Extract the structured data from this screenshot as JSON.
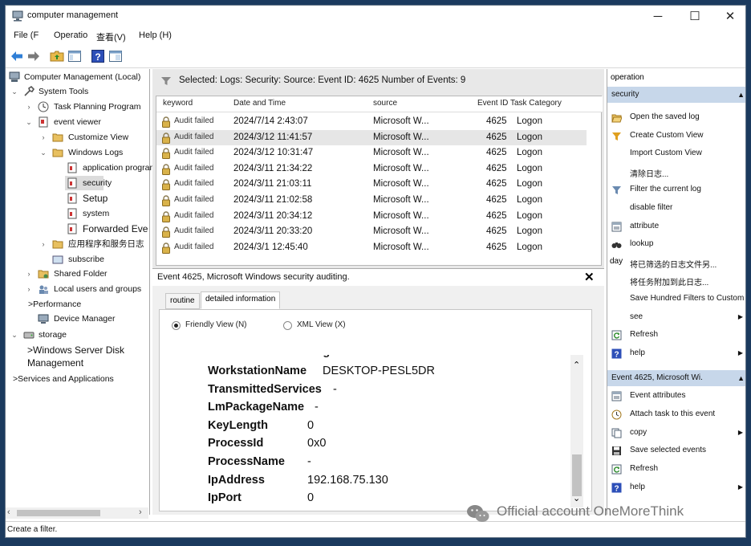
{
  "window": {
    "title": "computer management",
    "app_icon": "computer-management-icon",
    "controls": [
      "─",
      "☐",
      "✕"
    ]
  },
  "menu": [
    "File (F",
    "Operatio",
    "查看(V)",
    "Help (H)"
  ],
  "toolbar": {
    "buttons": [
      "back-arrow-icon",
      "forward-arrow-icon",
      "folder-up-icon",
      "console-tree-icon",
      "help-icon",
      "show-pane-icon"
    ]
  },
  "tree": {
    "root": "Computer Management (Local)",
    "system_tools": "System Tools",
    "task_planning": "Task Planning Program",
    "event_viewer": "event viewer",
    "custom_view": "Customize View",
    "windows_logs": "Windows Logs",
    "application": "application program",
    "security": "security",
    "setup": "Setup",
    "system": "system",
    "forwarded": "Forwarded Eve",
    "app_services": "应用程序和服务日志",
    "subscribe": "subscribe",
    "shared_folder": "Shared Folder",
    "local_users": "Local users and groups",
    "performance": ">Performance",
    "device_manager": "Device Manager",
    "storage": "storage",
    "disk_mgmt_1": ">Windows Server Disk",
    "disk_mgmt_2": "Management",
    "services_apps": ">Services and Applications"
  },
  "events_pane": {
    "selected_text": "Selected: Logs: Security: Source: Event ID: 4625 Number of Events: 9",
    "columns": [
      "keyword",
      "Date and Time",
      "source",
      "Event ID Task Category"
    ],
    "rows": [
      {
        "keyword": "Audit failed",
        "datetime": "2024/7/14 2:43:07",
        "source": "Microsoft W...",
        "id": "4625",
        "category": "Logon"
      },
      {
        "keyword": "Audit failed",
        "datetime": "2024/3/12 11:41:57",
        "source": "Microsoft W...",
        "id": "4625",
        "category": "Logon"
      },
      {
        "keyword": "Audit failed",
        "datetime": "2024/3/12 10:31:47",
        "source": "Microsoft W...",
        "id": "4625",
        "category": "Logon"
      },
      {
        "keyword": "Audit failed",
        "datetime": "2024/3/11 21:34:22",
        "source": "Microsoft W...",
        "id": "4625",
        "category": "Logon"
      },
      {
        "keyword": "Audit failed",
        "datetime": "2024/3/11 21:03:11",
        "source": "Microsoft W...",
        "id": "4625",
        "category": "Logon"
      },
      {
        "keyword": "Audit failed",
        "datetime": "2024/3/11 21:02:58",
        "source": "Microsoft W...",
        "id": "4625",
        "category": "Logon"
      },
      {
        "keyword": "Audit failed",
        "datetime": "2024/3/11 20:34:12",
        "source": "Microsoft W...",
        "id": "4625",
        "category": "Logon"
      },
      {
        "keyword": "Audit failed",
        "datetime": "2024/3/11 20:33:20",
        "source": "Microsoft W...",
        "id": "4625",
        "category": "Logon"
      },
      {
        "keyword": "Audit failed",
        "datetime": "2024/3/1 12:45:40",
        "source": "Microsoft W...",
        "id": "4625",
        "category": "Logon"
      }
    ]
  },
  "detail": {
    "title": "Event 4625, Microsoft Windows security auditing.",
    "close": "✕",
    "tabs": [
      "routine",
      "detailed information"
    ],
    "friendly_view": "Friendly View (N)",
    "xml_view": "XML View (X)",
    "fields": [
      {
        "key": "WorkstationName",
        "value": "DESKTOP-PESL5DR"
      },
      {
        "key": "TransmittedServices",
        "value": "-"
      },
      {
        "key": "LmPackageName",
        "value": "-"
      },
      {
        "key": "KeyLength",
        "value": "0"
      },
      {
        "key": "ProcessId",
        "value": "0x0"
      },
      {
        "key": "ProcessName",
        "value": "-"
      },
      {
        "key": "IpAddress",
        "value": "192.168.75.130"
      },
      {
        "key": "IpPort",
        "value": "0"
      }
    ]
  },
  "actions": {
    "header": "operation",
    "security_section": "security",
    "security_items": [
      {
        "label": "Open the saved log",
        "icon": "folder-open-icon",
        "submenu": false
      },
      {
        "label": "Create Custom View",
        "icon": "funnel-star-icon",
        "submenu": false
      },
      {
        "label": "Import Custom View",
        "icon": "",
        "submenu": false
      },
      {
        "label": "清除日志...",
        "icon": "",
        "submenu": false
      },
      {
        "label": "Filter the current log",
        "icon": "funnel-icon",
        "submenu": false
      },
      {
        "label": "disable filter",
        "icon": "",
        "submenu": false
      },
      {
        "label": "attribute",
        "icon": "properties-icon",
        "submenu": false
      },
      {
        "label": "lookup",
        "icon": "binoculars-icon",
        "submenu": false
      },
      {
        "label": "将已筛选的日志文件另...",
        "icon": "",
        "submenu": false
      },
      {
        "label": "将任务附加到此日志...",
        "icon": "",
        "submenu": false
      },
      {
        "label": "Save Hundred Filters to Custom",
        "icon": "",
        "submenu": false
      },
      {
        "label": "see",
        "icon": "",
        "submenu": true
      },
      {
        "label": "Refresh",
        "icon": "refresh-icon",
        "submenu": false
      },
      {
        "label": "help",
        "icon": "help-icon",
        "submenu": true
      }
    ],
    "day_label": "day",
    "event_section": "Event 4625, Microsoft Wi.",
    "event_items": [
      {
        "label": "Event attributes",
        "icon": "properties-icon",
        "submenu": false
      },
      {
        "label": "Attach task to this event",
        "icon": "task-icon",
        "submenu": false
      },
      {
        "label": "copy",
        "icon": "copy-icon",
        "submenu": true
      },
      {
        "label": "Save selected events",
        "icon": "save-icon",
        "submenu": false
      },
      {
        "label": "Refresh",
        "icon": "refresh-icon",
        "submenu": false
      },
      {
        "label": "help",
        "icon": "help-icon",
        "submenu": true
      }
    ]
  },
  "status": "Create a filter.",
  "watermark": "Official account OneMoreThink"
}
